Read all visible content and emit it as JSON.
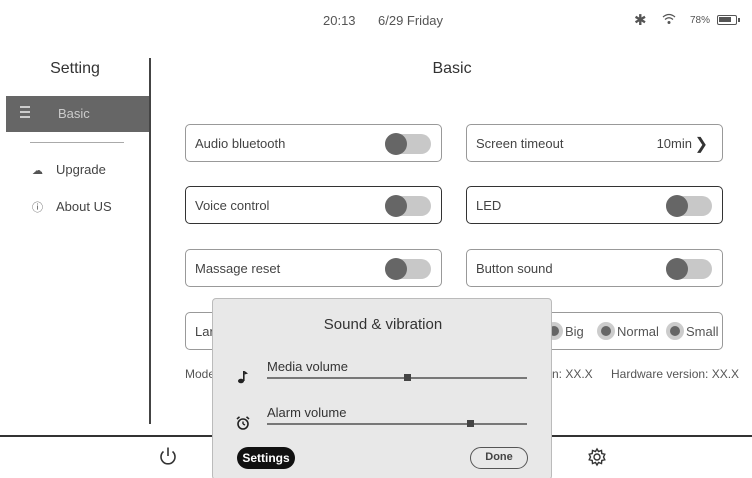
{
  "status": {
    "time": "20:13",
    "date": "6/29 Friday",
    "battery": "78%",
    "battery_level": 0.78,
    "icons": [
      "bluetooth-icon",
      "wifi-icon",
      "battery-icon"
    ]
  },
  "sidebar": {
    "title": "Setting",
    "items": [
      {
        "label": "Basic",
        "icon": "sliders-icon",
        "active": true
      },
      {
        "label": "Upgrade",
        "icon": "cloud-upload-icon"
      },
      {
        "label": "About US",
        "icon": "info-icon"
      }
    ]
  },
  "main": {
    "title": "Basic",
    "cards": {
      "audio_bluetooth": {
        "label": "Audio bluetooth",
        "on": false
      },
      "screen_timeout": {
        "label": "Screen timeout",
        "value": "10min"
      },
      "voice_control": {
        "label": "Voice control",
        "on": false
      },
      "led": {
        "label": "LED",
        "on": false
      },
      "massage_reset": {
        "label": "Massage reset",
        "on": false
      },
      "button_sound": {
        "label": "Button sound",
        "on": false
      },
      "language_partial": "Lar",
      "font_size_options": [
        "Big",
        "Normal",
        "Small"
      ]
    },
    "info": {
      "model_partial": "Mode",
      "software_partial": "n: XX.X",
      "hardware": "Hardware version: XX.X"
    }
  },
  "modal": {
    "title": "Sound & vibration",
    "media": {
      "label": "Media volume",
      "level": 0.54
    },
    "alarm": {
      "label": "Alarm volume",
      "level": 0.78
    },
    "settings_label": "Settings",
    "done_label": "Done"
  },
  "bottom": {
    "icons": [
      "power-icon",
      "gear-icon"
    ]
  }
}
